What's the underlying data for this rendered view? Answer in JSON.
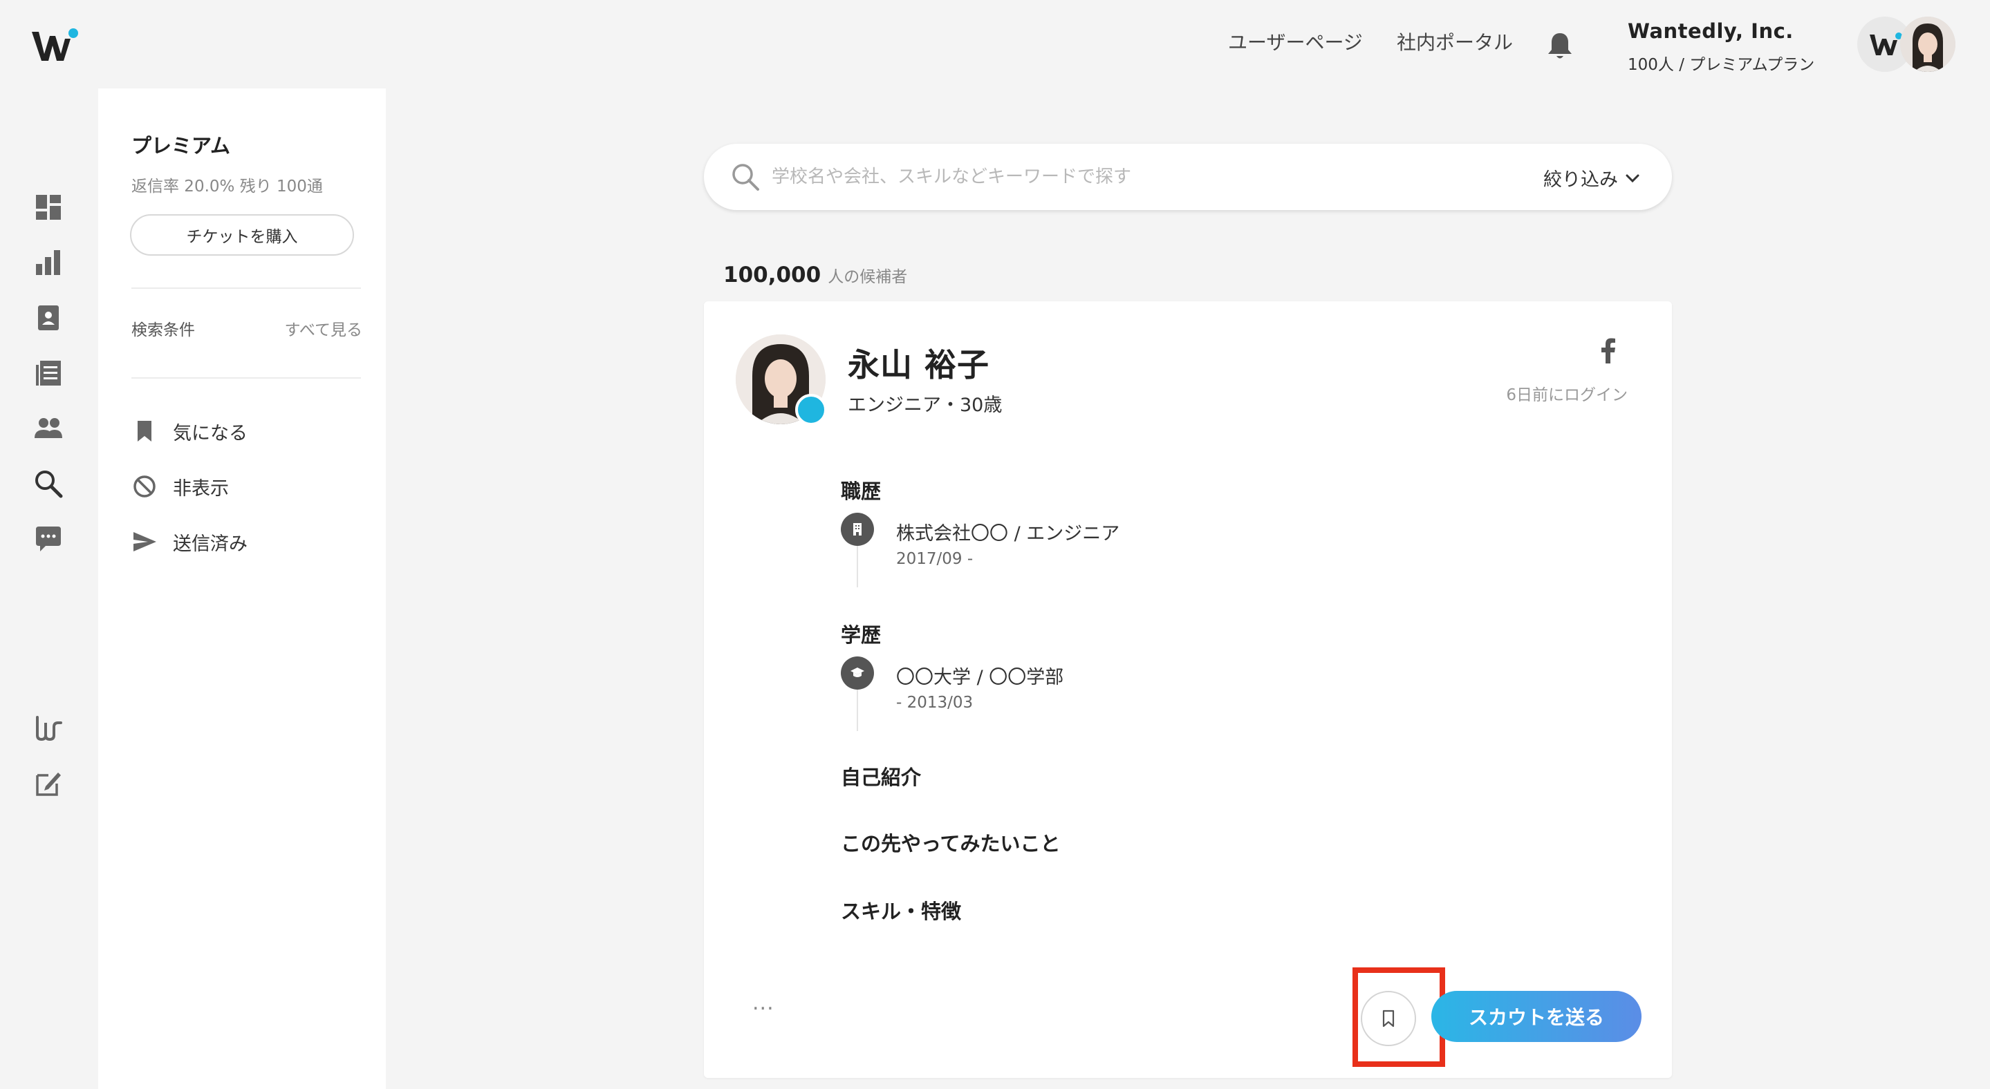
{
  "header": {
    "nav": [
      "ユーザーページ",
      "社内ポータル"
    ],
    "company_name": "Wantedly, Inc.",
    "company_sub": "100人 / プレミアムプラン",
    "accent_color": "#1fb6e0"
  },
  "rail": {
    "icons": [
      "dashboard-icon",
      "bar-chart-icon",
      "contact-icon",
      "articles-icon",
      "people-icon",
      "search-icon",
      "chat-icon",
      "brand-icon",
      "edit-icon"
    ]
  },
  "sidebar": {
    "plan_title": "プレミアム",
    "stats": "返信率 20.0%  残り 100通",
    "ticket_button": "チケットを購入",
    "search_conditions_label": "検索条件",
    "see_all_label": "すべて見る",
    "items": [
      {
        "label": "気になる",
        "icon": "bookmark-icon"
      },
      {
        "label": "非表示",
        "icon": "block-icon"
      },
      {
        "label": "送信済み",
        "icon": "send-icon"
      }
    ]
  },
  "search": {
    "placeholder": "学校名や会社、スキルなどキーワードで探す",
    "value": "",
    "filter_label": "絞り込み"
  },
  "results": {
    "count": "100,000",
    "count_unit": "人の候補者"
  },
  "candidate": {
    "name": "永山 裕子",
    "role": "エンジニア・30歳",
    "last_login": "6日前にログイン",
    "sections": {
      "work_title": "職歴",
      "work": {
        "title": "株式会社〇〇 / エンジニア",
        "date": "2017/09 -"
      },
      "edu_title": "学歴",
      "edu": {
        "title": "〇〇大学 / 〇〇学部",
        "date": "- 2013/03"
      },
      "intro_title": "自己紹介",
      "future_title": "この先やってみたいこと",
      "skills_title": "スキル・特徴"
    },
    "more_label": "...",
    "scout_button": "スカウトを送る"
  }
}
